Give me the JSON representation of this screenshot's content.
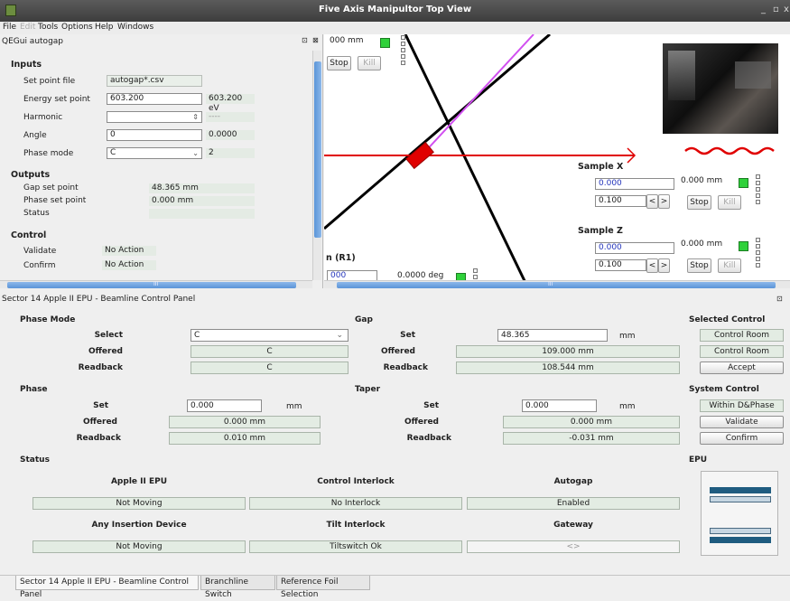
{
  "window": {
    "title": "Five Axis Manipultor Top View",
    "menu": [
      "File",
      "Edit",
      "Tools",
      "Options",
      "Help",
      "Windows"
    ],
    "controls": [
      "_",
      "▫",
      "x"
    ]
  },
  "autogap": {
    "title": "QEGui autogap",
    "inputs_title": "Inputs",
    "set_point_file_label": "Set point file",
    "set_point_file_value": "autogap*.csv",
    "energy_label": "Energy set point",
    "energy_value": "603.200",
    "energy_readback": "603.200 eV",
    "harmonic_label": "Harmonic",
    "harmonic_value": "",
    "harmonic_readback": "----",
    "angle_label": "Angle",
    "angle_value": "0",
    "angle_readback": "0.0000",
    "phase_mode_label": "Phase mode",
    "phase_mode_value": "C",
    "phase_mode_readback": "2",
    "outputs_title": "Outputs",
    "gap_sp_label": "Gap set point",
    "gap_sp_value": "48.365 mm",
    "phase_sp_label": "Phase set point",
    "phase_sp_value": "0.000 mm",
    "status_label": "Status",
    "status_value": "",
    "control_title": "Control",
    "validate_label": "Validate",
    "validate_value": "No Action",
    "confirm_label": "Confirm",
    "confirm_value": "No Action",
    "hscroll_label": "III"
  },
  "view": {
    "top_readout": "000 mm",
    "stop": "Stop",
    "kill": "Kill",
    "sample_x": {
      "title": "Sample X",
      "setpoint": "0.000",
      "readback": "0.000 mm",
      "step": "0.100",
      "dec": "<",
      "inc": ">",
      "stop": "Stop",
      "kill": "Kill"
    },
    "sample_z": {
      "title": "Sample Z",
      "setpoint": "0.000",
      "readback": "0.000 mm",
      "step": "0.100",
      "dec": "<",
      "inc": ">",
      "stop": "Stop",
      "kill": "Kill"
    },
    "rotation_label": "n (R1)",
    "rotation_setpoint": "000",
    "rotation_readback": "0.0000 deg",
    "hscroll_label": "III",
    "colors": {
      "beam": "#e00000",
      "sample": "#e00000",
      "axis": "#000000",
      "magenta": "#d14ff0",
      "led": "#2fd13a"
    }
  },
  "panel": {
    "title": "Sector 14 Apple II EPU - Beamline Control Panel",
    "phase_mode": {
      "title": "Phase Mode",
      "select_label": "Select",
      "select_value": "C",
      "offered_label": "Offered",
      "offered_value": "C",
      "readback_label": "Readback",
      "readback_value": "C"
    },
    "gap": {
      "title": "Gap",
      "set_label": "Set",
      "set_value": "48.365",
      "set_unit": "mm",
      "offered_label": "Offered",
      "offered_value": "109.000 mm",
      "readback_label": "Readback",
      "readback_value": "108.544 mm"
    },
    "selected_control": {
      "title": "Selected Control",
      "value1": "Control Room",
      "value2": "Control Room",
      "accept": "Accept"
    },
    "phase": {
      "title": "Phase",
      "set_label": "Set",
      "set_value": "0.000",
      "set_unit": "mm",
      "offered_label": "Offered",
      "offered_value": "0.000 mm",
      "readback_label": "Readback",
      "readback_value": "0.010 mm"
    },
    "taper": {
      "title": "Taper",
      "set_label": "Set",
      "set_value": "0.000",
      "set_unit": "mm",
      "offered_label": "Offered",
      "offered_value": "0.000 mm",
      "readback_label": "Readback",
      "readback_value": "-0.031 mm"
    },
    "system_control": {
      "title": "System Control",
      "value": "Within D&Phase",
      "validate": "Validate",
      "confirm": "Confirm"
    },
    "status": {
      "title": "Status",
      "apple_label": "Apple II EPU",
      "apple_value": "Not Moving",
      "interlock_label": "Control Interlock",
      "interlock_value": "No Interlock",
      "autogap_label": "Autogap",
      "autogap_value": "Enabled",
      "insertion_label": "Any Insertion Device",
      "insertion_value": "Not Moving",
      "tilt_label": "Tilt Interlock",
      "tilt_value": "Tiltswitch Ok",
      "gateway_label": "Gateway",
      "gateway_value": "<>"
    },
    "epu": {
      "title": "EPU",
      "colors": {
        "dark": "#1f5c80",
        "light": "#c6d6e2"
      }
    }
  },
  "tabs": [
    "Sector 14 Apple II EPU - Beamline Control Panel",
    "Branchline Switch",
    "Reference Foil Selection"
  ]
}
